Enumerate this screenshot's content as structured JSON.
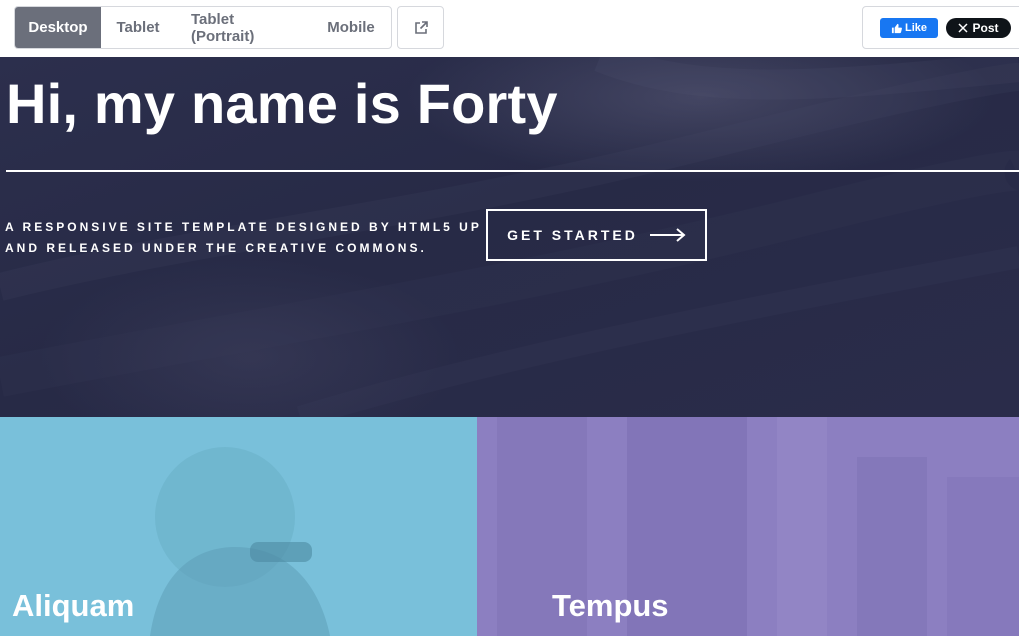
{
  "toolbar": {
    "devices": [
      "Desktop",
      "Tablet",
      "Tablet (Portrait)",
      "Mobile"
    ],
    "active_device": "Desktop",
    "external_icon": "external-link-icon",
    "facebook_like_label": "Like",
    "x_post_label": "Post"
  },
  "banner": {
    "title": "Hi, my name is Forty",
    "subtitle_line1": "A RESPONSIVE SITE TEMPLATE DESIGNED BY HTML5 UP",
    "subtitle_line2": "AND RELEASED UNDER THE CREATIVE COMMONS.",
    "cta_label": "GET STARTED",
    "cta_icon": "arrow-right-icon"
  },
  "tiles": [
    {
      "label": "Aliquam",
      "color": "#79c0da"
    },
    {
      "label": "Tempus",
      "color": "#8c7fc1"
    }
  ],
  "colors": {
    "banner_bg": "#2a2c4a",
    "active_tab": "#6b6f7b",
    "facebook_blue": "#1877f2",
    "x_black": "#0f1419"
  }
}
